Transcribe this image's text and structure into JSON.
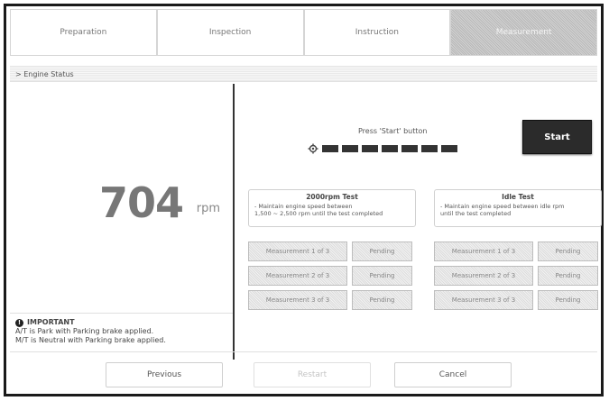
{
  "tabs": [
    {
      "label": "Preparation",
      "active": false
    },
    {
      "label": "Inspection",
      "active": false
    },
    {
      "label": "Instruction",
      "active": false
    },
    {
      "label": "Measurement",
      "active": true
    }
  ],
  "subbar": {
    "label": "> Engine Status"
  },
  "rpm": {
    "value": "704",
    "unit": "rpm"
  },
  "notice": {
    "title": "IMPORTANT",
    "lines": [
      "A/T is Park with Parking brake applied.",
      "M/T is Neutral with Parking brake applied."
    ]
  },
  "test_area": {
    "prompt": "Press 'Start' button",
    "progress_segments": 7,
    "start_label": "Start"
  },
  "tests": [
    {
      "title": "2000rpm Test",
      "desc": [
        "- Maintain engine speed between",
        "1,500 ~ 2,500 rpm until the test completed"
      ],
      "rows": [
        {
          "label": "Measurement 1 of 3",
          "status": "Pending"
        },
        {
          "label": "Measurement 2 of 3",
          "status": "Pending"
        },
        {
          "label": "Measurement 3 of 3",
          "status": "Pending"
        }
      ]
    },
    {
      "title": "Idle Test",
      "desc": [
        "- Maintain engine speed between idle rpm",
        "until the test completed"
      ],
      "rows": [
        {
          "label": "Measurement 1 of 3",
          "status": "Pending"
        },
        {
          "label": "Measurement 2 of 3",
          "status": "Pending"
        },
        {
          "label": "Measurement 3 of 3",
          "status": "Pending"
        }
      ]
    }
  ],
  "footer": {
    "previous": "Previous",
    "restart": "Restart",
    "cancel": "Cancel"
  }
}
